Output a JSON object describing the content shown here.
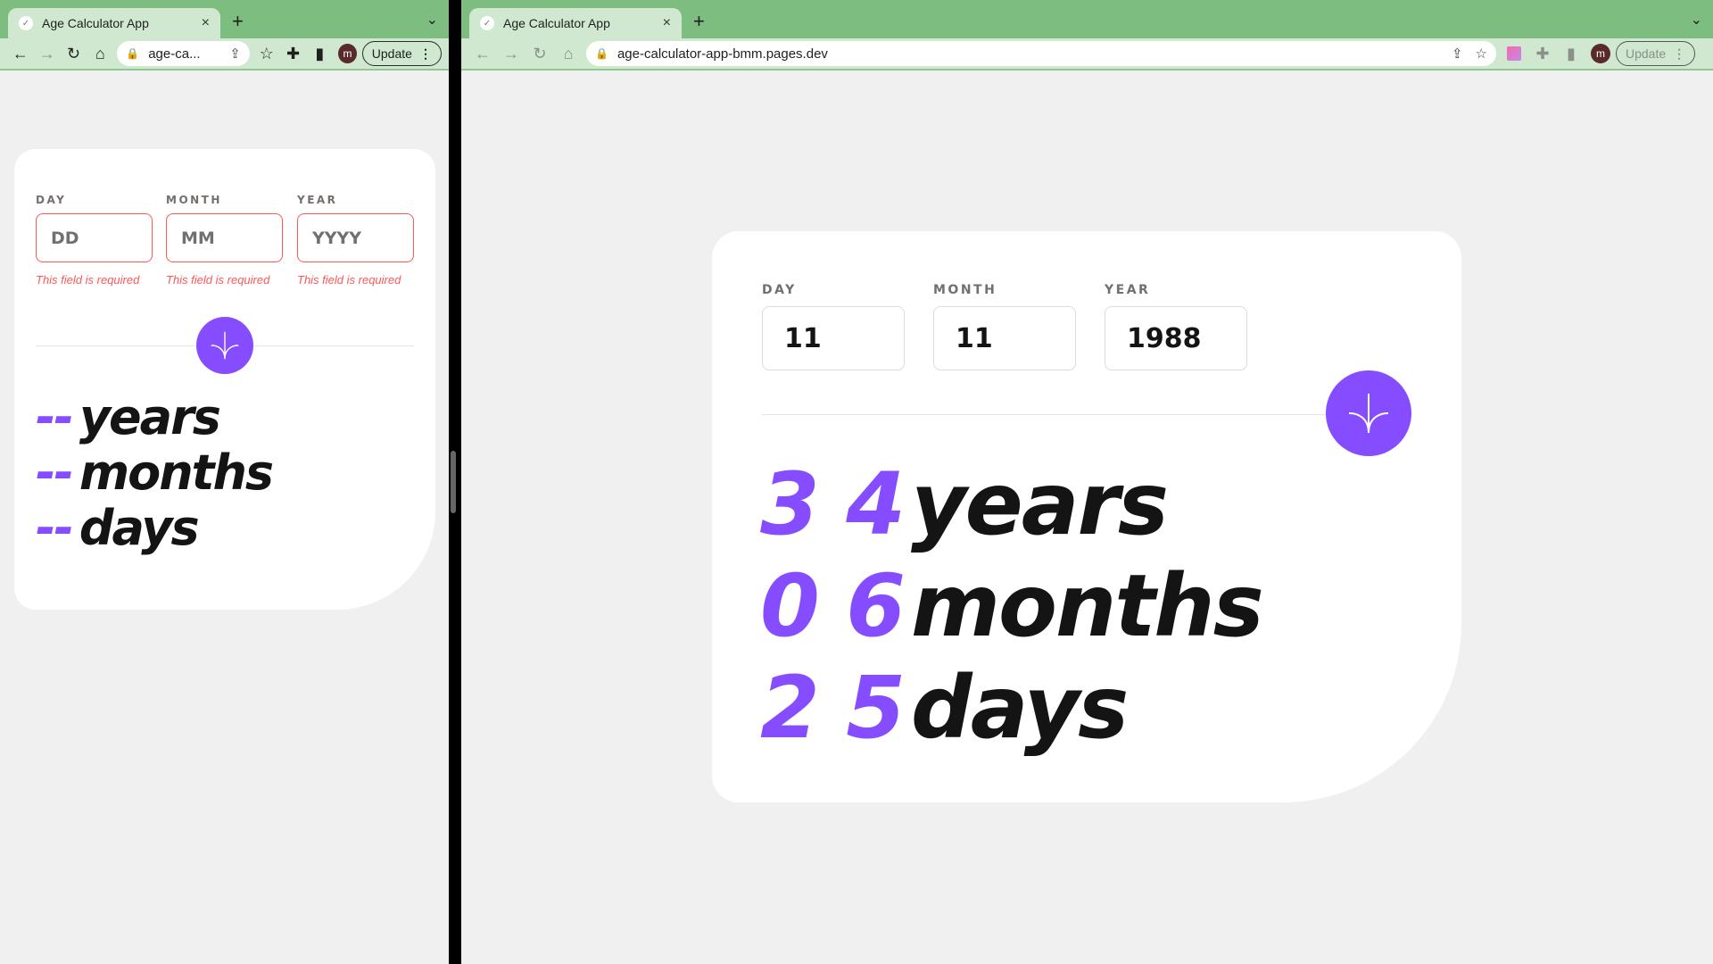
{
  "left": {
    "tab": {
      "title": "Age Calculator App",
      "close": "×"
    },
    "newtab": "+",
    "url": "age-ca...",
    "avatar": "m",
    "update": "Update",
    "labels": {
      "day": "DAY",
      "month": "MONTH",
      "year": "YEAR"
    },
    "placeholders": {
      "day": "DD",
      "month": "MM",
      "year": "YYYY"
    },
    "error": "This field is required",
    "results": {
      "years_num": "--",
      "months_num": "--",
      "days_num": "--",
      "years": "years",
      "months": "months",
      "days": "days"
    }
  },
  "right": {
    "tab": {
      "title": "Age Calculator App",
      "close": "×"
    },
    "newtab": "+",
    "url": "age-calculator-app-bmm.pages.dev",
    "avatar": "m",
    "update": "Update",
    "labels": {
      "day": "DAY",
      "month": "MONTH",
      "year": "YEAR"
    },
    "values": {
      "day": "11",
      "month": "11",
      "year": "1988"
    },
    "results": {
      "years_num": "3 4",
      "months_num": "0 6",
      "days_num": "2 5",
      "years": "years",
      "months": "months",
      "days": "days"
    }
  },
  "colors": {
    "accent": "#854dff",
    "error": "#ff5757",
    "chrome": "#7dbd7f"
  }
}
